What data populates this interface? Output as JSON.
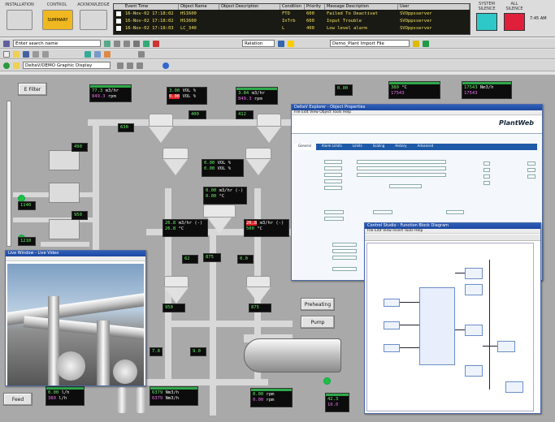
{
  "header": {
    "left_buttons": [
      {
        "caption": "INSTALLATION",
        "label": ""
      },
      {
        "caption": "CONTROL",
        "label": "SUMMARY"
      },
      {
        "caption": "ACKNOWLEDGE",
        "label": ""
      }
    ],
    "right_buttons": [
      {
        "caption": "SYSTEM\nSILENCE",
        "color": "#2fc8c8"
      },
      {
        "caption": "ALL\nSILENCE",
        "color": "#e0203a"
      }
    ],
    "right_text": "7:45 AM"
  },
  "alarm_banner": {
    "columns": [
      "Event Time",
      "Object Name",
      "Object Description",
      "Condition",
      "Priority",
      "Message Description",
      "User"
    ],
    "rows": [
      {
        "time": "16-Nov-02 17:18:02",
        "object": "HSI600",
        "desc": "",
        "condition": "FTD",
        "priority": "600",
        "message": "Failed To Deactivat",
        "user": "SVOppsserver"
      },
      {
        "time": "16-Nov-02 17:18:02",
        "object": "HSI600",
        "desc": "",
        "condition": "InTrb",
        "priority": "600",
        "message": "Input Trouble",
        "user": "SVOppsserver"
      },
      {
        "time": "16-Nov-02 17:18:03",
        "object": "LC_340",
        "desc": "",
        "condition": "L",
        "priority": "400",
        "message": "Low level alarm",
        "user": "SVOppsserver"
      }
    ]
  },
  "toolbar1": {
    "search_placeholder": "Enter search name",
    "relation_select": "Relation",
    "path_select": "Demo_Plant Import File"
  },
  "toolbar3": {
    "address": "DeltaV/DEMO Graphic Display"
  },
  "canvas": {
    "efilter_button": "E Filter",
    "feed_button": "Feed",
    "preheat_button": "Preheating",
    "pump_button": "Pump",
    "readouts": {
      "r_top1": {
        "v1": "3.00",
        "u1": "VOL %",
        "v2": "0.00",
        "u2": "VOL %"
      },
      "r_top2": {
        "v1": "77.3",
        "u1": "m3/hr",
        "v2": "849.3",
        "u2": "rpm"
      },
      "r_top3": {
        "v1": "3.84",
        "u1": "m3/hr",
        "v2": "849.3",
        "u2": "rpm"
      },
      "r_top4": {
        "v1": "0.00",
        "u1": "",
        "v2": "",
        "u2": ""
      },
      "r_top5": {
        "v1": "380",
        "u1": "°C",
        "v2": "17543",
        "u2": ""
      },
      "r_top6": {
        "v1": "17543",
        "u1": "Nm3/h",
        "v2": "17543",
        "u2": ""
      },
      "r_mid1": {
        "v1": "0.00",
        "u1": "VOL %",
        "v2": "0.00",
        "u2": "VOL %"
      },
      "r_mid2": {
        "v1": "0.00",
        "u1": "m3/hr (-)",
        "v2": "0.00",
        "u2": "°C"
      },
      "r_mid3": {
        "v1": "26.8",
        "u1": "m3/hr (-)",
        "v2": "26.8",
        "u2": "°C"
      },
      "r_mid4": {
        "v1": "26.8",
        "u1": "m3/hr (-)",
        "v2": "500",
        "u2": "°C"
      },
      "r_bot1": {
        "v1": "0.00",
        "u1": "l/h",
        "v2": "380",
        "u2": "l/h"
      },
      "r_bot2": {
        "v1": "6379",
        "u1": "Nm3/h",
        "v2": "6379",
        "u2": "Nm3/h"
      },
      "r_bot3": {
        "v1": "0.00",
        "u1": "rpm",
        "v2": "0.00",
        "u2": "rpm"
      },
      "r_bot4": {
        "v1": "42.3",
        "u1": "",
        "v2": "10.0",
        "u2": ""
      }
    },
    "small_values": [
      "400",
      "630",
      "412",
      "490",
      "950",
      "950",
      "1140",
      "1210",
      "875",
      "875",
      "9.0",
      "7.0",
      "62",
      "0.0"
    ]
  },
  "window_camera": {
    "title": "Live Window - Live Video"
  },
  "window_form": {
    "title": "DeltaV Explorer - Object Properties",
    "menu": "File  Edit  View  Object  Tools  Help",
    "tabs": [
      "General",
      "Alarm Limits",
      "Limits",
      "Scaling",
      "History",
      "Advanced"
    ],
    "brand": "PlantWeb"
  },
  "window_diagram": {
    "title": "Control Studio - Function Block Diagram",
    "menu": "File  Edit  View  Insert  Tools  Help"
  }
}
